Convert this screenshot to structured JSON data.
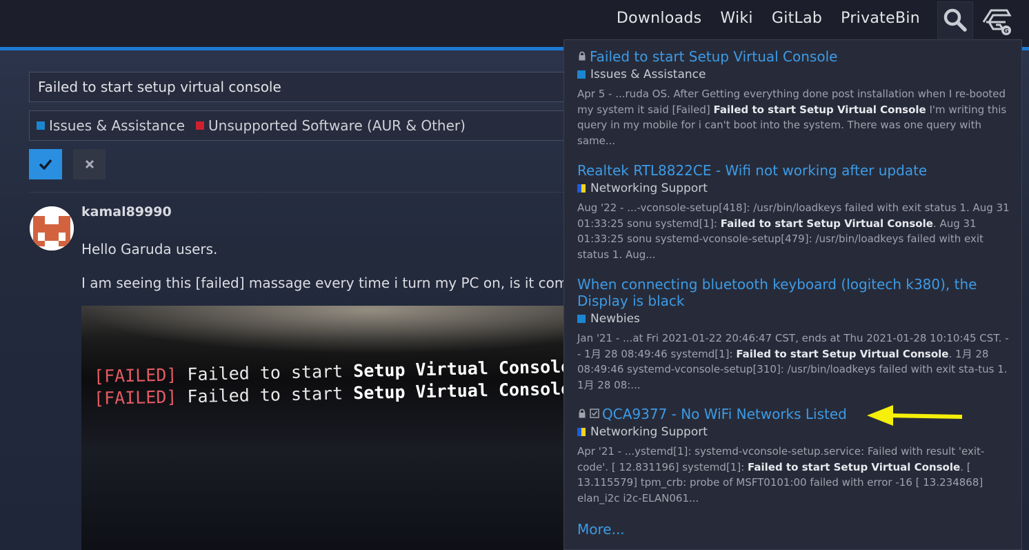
{
  "nav": {
    "links": [
      "Downloads",
      "Wiki",
      "GitLab",
      "PrivateBin"
    ]
  },
  "editor": {
    "title_value": "Failed to start setup virtual console",
    "categories": [
      {
        "label": "Issues & Assistance",
        "color": "#1b86d1"
      },
      {
        "label": "Unsupported Software (AUR & Other)",
        "color": "#d0202f"
      }
    ],
    "confirm_icon": "check-icon",
    "cancel_icon": "close-icon"
  },
  "post": {
    "username": "kamal89990",
    "line1": "Hello Garuda users.",
    "line2": "I am seeing this [failed] massage every time i turn my PC on, is it com",
    "photo_lines": [
      {
        "fail": "[FAILED]",
        "plain": " Failed to start ",
        "bold": "Setup Virtual Console"
      },
      {
        "fail": "[FAILED]",
        "plain": " Failed to start ",
        "bold": "Setup Virtual Console"
      }
    ]
  },
  "search_results": {
    "items": [
      {
        "title": "Failed to start Setup Virtual Console",
        "locked": true,
        "solved": false,
        "category": "Issues & Assistance",
        "category_color": "#1b86d1",
        "category_split": false,
        "blurb_before": "Apr 5 - ...ruda OS. After Getting everything done post installation when I re-booted my system it said [Failed] ",
        "blurb_bold": "Failed to start Setup Virtual Console",
        "blurb_after": " I'm writing this query in my mobile for i can't boot into the system. There was one query with same..."
      },
      {
        "title": "Realtek RTL8822CE - Wifi not working after update",
        "locked": false,
        "solved": false,
        "category": "Networking Support",
        "category_color": "#1e5bd8",
        "category_split": true,
        "blurb_before": "Aug '22 - ...-vconsole-setup[418]: /usr/bin/loadkeys failed with exit status 1. Aug 31 01:33:25 sonu systemd[1]: ",
        "blurb_bold": "Failed to start Setup Virtual Console",
        "blurb_after": ". Aug 31 01:33:25 sonu systemd-vconsole-setup[479]: /usr/bin/loadkeys failed with exit status 1. Aug..."
      },
      {
        "title": "When connecting bluetooth keyboard (logitech k380), the Display is black",
        "locked": false,
        "solved": false,
        "category": "Newbies",
        "category_color": "#1b86d1",
        "category_split": false,
        "blurb_before": "Jan '21 - ...at Fri 2021-01-22 20:46:47 CST, ends at Thu 2021-01-28 10:10:45 CST. -- 1月 28 08:49:46 systemd[1]: ",
        "blurb_bold": "Failed to start Setup Virtual Console",
        "blurb_after": ". 1月 28 08:49:46 systemd-vconsole-setup[310]: /usr/bin/loadkeys failed with exit sta-tus 1. 1月 28 08:..."
      },
      {
        "title": "QCA9377 - No WiFi Networks Listed",
        "locked": true,
        "solved": true,
        "category": "Networking Support",
        "category_color": "#1e5bd8",
        "category_split": true,
        "blurb_before": "Apr '21 - ...ystemd[1]: systemd-vconsole-setup.service: Failed with result 'exit-code'. [ 12.831196] systemd[1]: ",
        "blurb_bold": "Failed to start Setup Virtual Console",
        "blurb_after": ". [ 13.115579] tpm_crb: probe of MSFT0101:00 failed with error -16 [ 13.234868] elan_i2c i2c-ELAN061..."
      }
    ],
    "more_label": "More...",
    "annotation_color": "#f5ef0a"
  }
}
